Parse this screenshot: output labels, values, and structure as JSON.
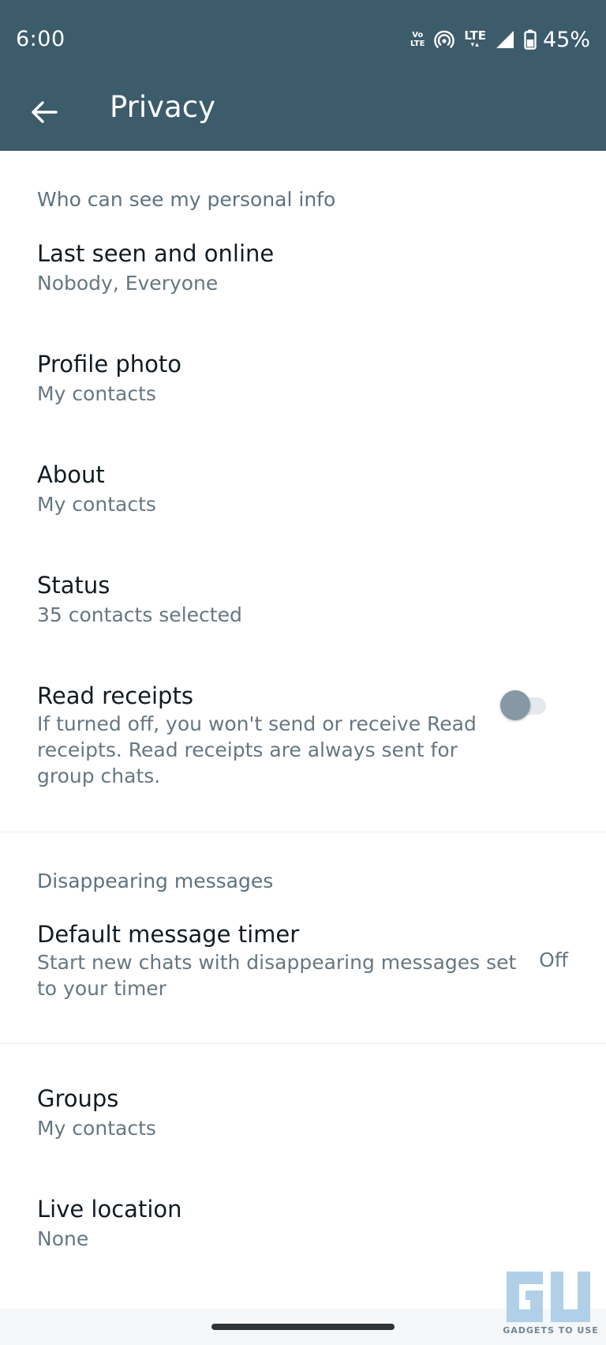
{
  "status_bar": {
    "time": "6:00",
    "volte_top": "Vo",
    "volte_bottom": "LTE",
    "network": "LTE",
    "battery": "45%"
  },
  "toolbar": {
    "title": "Privacy",
    "back_icon": "arrow-left-icon"
  },
  "sections": {
    "personal_info": {
      "header": "Who can see my personal info",
      "items": [
        {
          "title": "Last seen and online",
          "subtitle": "Nobody, Everyone"
        },
        {
          "title": "Profile photo",
          "subtitle": "My contacts"
        },
        {
          "title": "About",
          "subtitle": "My contacts"
        },
        {
          "title": "Status",
          "subtitle": "35 contacts selected"
        }
      ],
      "read_receipts": {
        "title": "Read receipts",
        "subtitle_lines": [
          "If turned off, you won't send or receive Read",
          "receipts. Read receipts are always sent for",
          "group chats."
        ],
        "enabled": false
      }
    },
    "disappearing": {
      "header": "Disappearing messages",
      "timer": {
        "title": "Default message timer",
        "subtitle_lines": [
          "Start new chats with disappearing messages set",
          "to your timer"
        ],
        "value": "Off"
      }
    },
    "other": {
      "items": [
        {
          "title": "Groups",
          "subtitle": "My contacts"
        },
        {
          "title": "Live location",
          "subtitle": "None"
        }
      ]
    }
  },
  "watermark": {
    "logo_text": "GU",
    "caption": "GADGETS TO USE"
  },
  "colors": {
    "appbar": "#3c5b6b",
    "primary_text": "#111b21",
    "secondary_text": "#667781",
    "section_header": "#5e7280"
  }
}
